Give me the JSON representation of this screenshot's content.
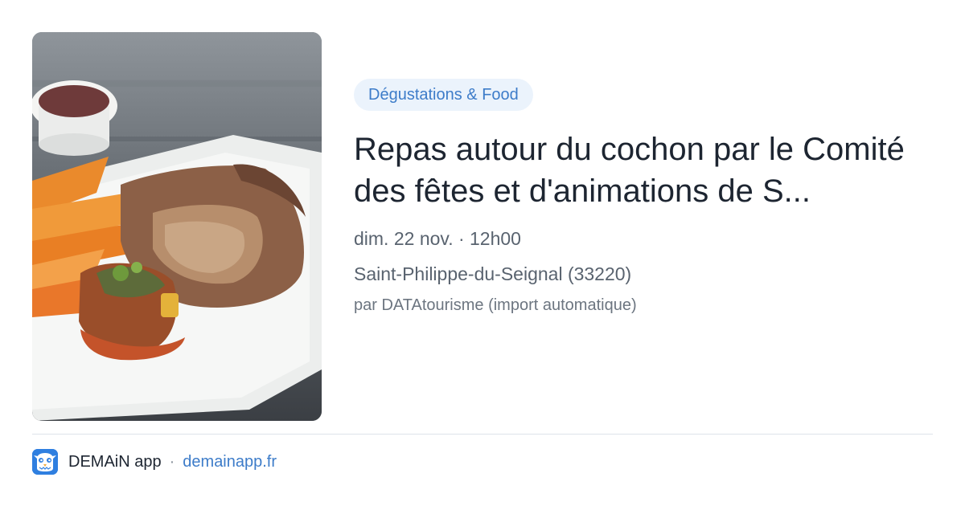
{
  "event": {
    "category": "Dégustations & Food",
    "title": "Repas autour du cochon par le Comité des fêtes et d'animations de S...",
    "datetime": "dim. 22 nov. · 12h00",
    "location": "Saint-Philippe-du-Seignal (33220)",
    "author": "par DATAtourisme (import automatique)"
  },
  "footer": {
    "app_name": "DEMAiN app",
    "separator": "·",
    "domain": "demainapp.fr",
    "logo_icon": "bird-mascot-icon"
  },
  "colors": {
    "accent": "#3d7cc9",
    "badge_bg": "#ebf3fc",
    "logo_bg": "#2f7fe0"
  }
}
